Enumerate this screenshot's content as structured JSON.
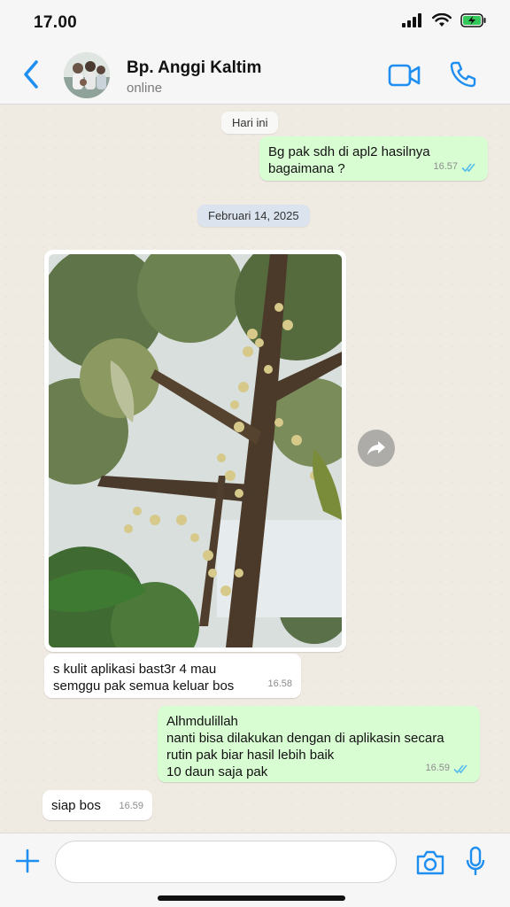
{
  "status_bar": {
    "time": "17.00"
  },
  "header": {
    "contact_name": "Bp. Anggi Kaltim",
    "contact_status": "online"
  },
  "chat": {
    "date_today": "Hari ini",
    "date_feb": "Februari 14, 2025",
    "messages": [
      {
        "direction": "out",
        "text": "Bg pak sdh di apl2 hasilnya\nbagaimana ?",
        "time": "16.57",
        "read": true
      },
      {
        "direction": "in",
        "type": "image",
        "image_alt": "durian tree flowering photo"
      },
      {
        "direction": "in",
        "text": "s kulit aplikasi bast3r 4 mau\nsemggu pak semua keluar bos",
        "time": "16.58"
      },
      {
        "direction": "out",
        "text": "Alhmdulillah\nnanti bisa dilakukan dengan di aplikasin secara\nrutin pak biar hasil lebih baik\n10 daun saja pak",
        "time": "16.59",
        "read": true
      },
      {
        "direction": "in",
        "text": "siap bos",
        "time": "16.59"
      }
    ]
  },
  "input_bar": {
    "placeholder": ""
  },
  "colors": {
    "accent": "#1f8ef1",
    "outgoing_bubble": "#d9fdd3",
    "incoming_bubble": "#ffffff",
    "read_ticks": "#53bdeb"
  },
  "icons": [
    "back-chevron-icon",
    "video-camera-icon",
    "phone-icon",
    "forward-icon",
    "plus-icon",
    "camera-icon",
    "microphone-icon"
  ]
}
